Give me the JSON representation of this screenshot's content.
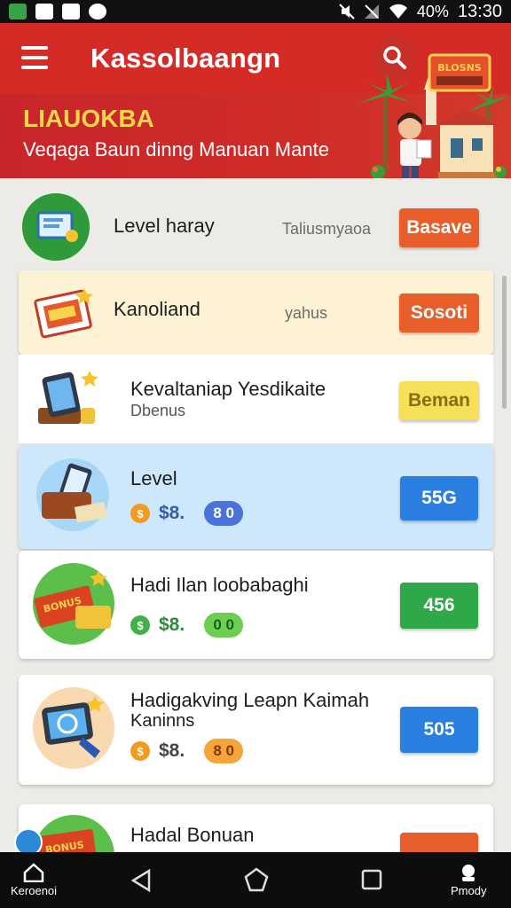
{
  "status_bar": {
    "battery": "40%",
    "time": "13:30",
    "icons": [
      "app-icon",
      "image-icon",
      "image-icon",
      "sync-icon",
      "mute-icon",
      "no-signal-icon",
      "wifi-icon"
    ]
  },
  "header": {
    "title": "Kassolbaangn",
    "menu_icon": "menu-icon",
    "search_icon": "search-icon",
    "banner_title": "LIAUOKBA",
    "banner_subtitle": "Veqaga Baun dinng Manuan Mante",
    "sign_text": "BLOSNS"
  },
  "rows": [
    {
      "title": "Level haray",
      "middle": "Taliusmyaoa",
      "button": "Basave",
      "icon": "monitor-icon"
    },
    {
      "title": "Kanoliand",
      "middle": "yahus",
      "button": "Sosoti",
      "icon": "lottery-ticket-icon"
    },
    {
      "title": "Kevaltaniap Yesdikaite",
      "subtitle": "Dbenus",
      "button": "Beman",
      "icon": "tablet-icon"
    },
    {
      "title": "Level",
      "price": "$8.",
      "pill": "8 0",
      "button": "55G",
      "icon": "wallet-phone-icon"
    },
    {
      "title": "Hadi Ilan loobabaghi",
      "price": "$8.",
      "pill": "0 0",
      "button": "456",
      "icon": "bonus-ticket-icon"
    },
    {
      "title": "Hadigakving Leapn Kaimah",
      "subtitle": "Kaninns",
      "price": "$8.",
      "pill": "8 0",
      "button": "505",
      "icon": "tablet-tap-icon"
    },
    {
      "title": "Hadal Bonuan",
      "icon": "bonus-ticket-icon"
    }
  ],
  "bonus_label": "BONUS",
  "navbar": {
    "left_label": "Keroenoi",
    "right_label": "Pmody",
    "icons": [
      "home-icon",
      "back-icon",
      "home-circle-icon",
      "recents-icon",
      "profile-icon"
    ]
  },
  "colors": {
    "header_red": "#d32a28",
    "accent_yellow": "#f8d64a",
    "button_orange": "#e85e2a",
    "button_blue": "#2b7fe0",
    "button_green": "#2fa84a"
  }
}
